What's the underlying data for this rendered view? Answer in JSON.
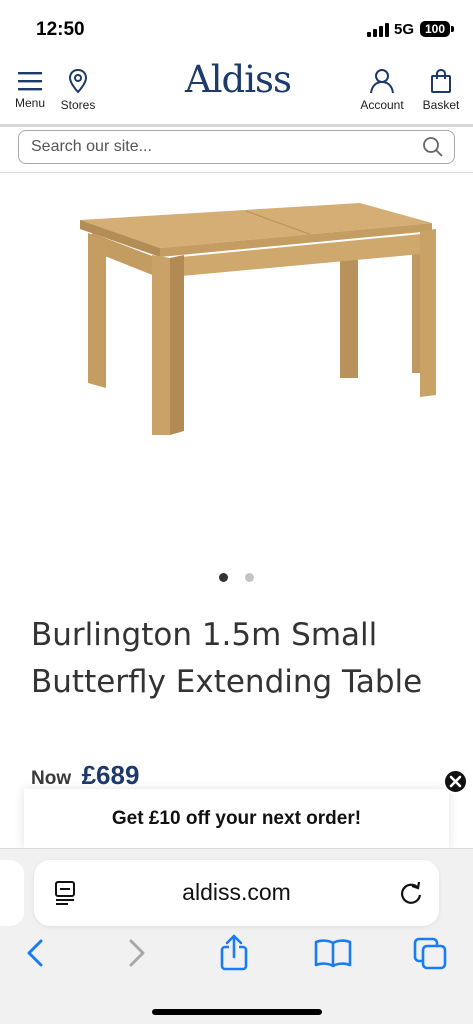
{
  "status_bar": {
    "time": "12:50",
    "network": "5G",
    "battery": "100"
  },
  "header": {
    "logo": "Aldiss",
    "menu_label": "Menu",
    "stores_label": "Stores",
    "account_label": "Account",
    "basket_label": "Basket"
  },
  "search": {
    "placeholder": "Search our site..."
  },
  "product": {
    "title": "Burlington 1.5m Small Butterfly Extending Table",
    "now_label": "Now",
    "price": "£689",
    "image_count": 2,
    "active_image": 1
  },
  "promo": {
    "text": "Get £10 off your next order!"
  },
  "browser": {
    "url": "aldiss.com"
  },
  "colors": {
    "brand_navy": "#1c3a6b",
    "ios_blue": "#1a7cf5",
    "wood": "#c9a26a"
  },
  "icons": [
    "menu-icon",
    "location-pin-icon",
    "account-icon",
    "basket-icon",
    "search-icon",
    "reader-icon",
    "reload-icon",
    "back-icon",
    "forward-icon",
    "share-icon",
    "bookmarks-icon",
    "tabs-icon",
    "close-icon"
  ]
}
